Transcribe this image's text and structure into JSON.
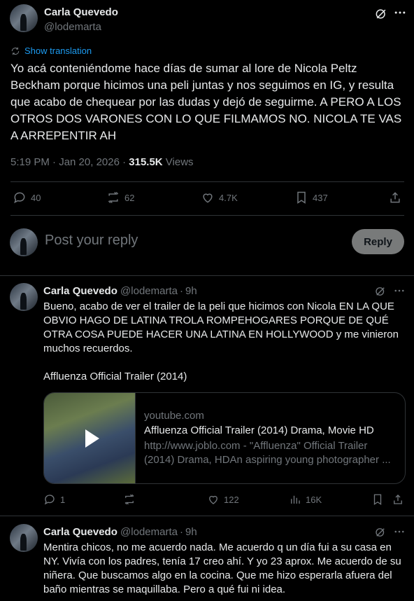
{
  "main": {
    "author_name": "Carla Quevedo",
    "author_handle": "@lodemarta",
    "translate_label": "Show translation",
    "text": "Yo acá conteniéndome hace días de sumar al lore de Nicola Peltz Beckham porque hicimos una peli juntas y nos seguimos en IG, y resulta que acabo de chequear por las dudas y dejó de seguirme. A PERO A LOS OTROS DOS VARONES CON LO QUE FILMAMOS NO. NICOLA TE VAS A ARREPENTIR AH",
    "timestamp": "5:19 PM · Jan 20, 2026 · ",
    "views_count": "315.5K",
    "views_label": " Views",
    "stats": {
      "replies": "40",
      "reposts": "62",
      "likes": "4.7K",
      "bookmarks": "437"
    }
  },
  "composer": {
    "placeholder": "Post your reply",
    "reply_button": "Reply"
  },
  "replies": [
    {
      "author_name": "Carla Quevedo",
      "author_handle": "@lodemarta",
      "age": "9h",
      "text": "Bueno, acabo de ver el trailer de la peli que hicimos con Nicola EN LA QUE OBVIO HAGO DE LATINA TROLA ROMPEHOGARES PORQUE DE QUÉ OTRA COSA PUEDE HACER UNA LATINA EN HOLLYWOOD y me vinieron muchos recuerdos.",
      "text2": "Affluenza Official Trailer (2014)",
      "card": {
        "domain": "youtube.com",
        "title": "Affluenza Official Trailer (2014) Drama, Movie HD",
        "description": "http://www.joblo.com - \"Affluenza\" Official Trailer (2014) Drama, HDAn aspiring young photographer ..."
      },
      "stats": {
        "replies": "1",
        "reposts": "",
        "likes": "122",
        "views": "16K"
      }
    },
    {
      "author_name": "Carla Quevedo",
      "author_handle": "@lodemarta",
      "age": "9h",
      "text": "Mentira chicos, no me acuerdo nada. Me acuerdo q un día fui a su casa en NY. Vivía con los padres, tenía 17 creo ahí. Y yo 23 aprox. Me acuerdo de su niñera. Que buscamos algo en la cocina. Que me hizo esperarla afuera del baño mientras se maquillaba. Pero a qué fui ni idea."
    }
  ],
  "colors": {
    "background": "#000000",
    "text": "#e7e9ea",
    "muted": "#71767b",
    "link": "#1d9bf0",
    "divider": "#2f3336"
  }
}
